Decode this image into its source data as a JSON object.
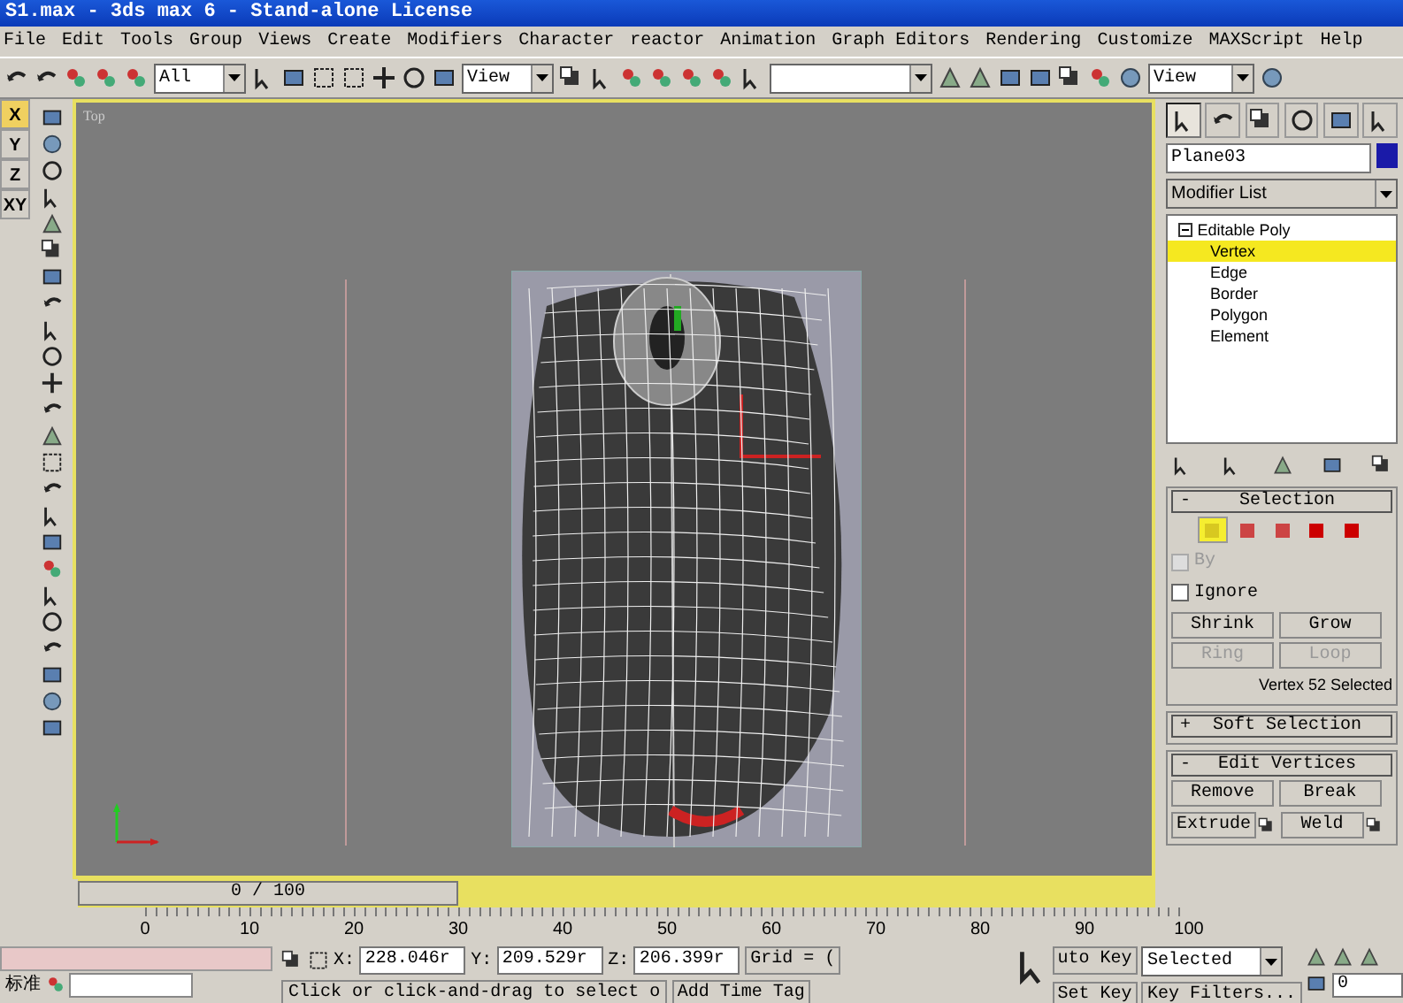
{
  "window": {
    "title": "S1.max - 3ds max 6 - Stand-alone License"
  },
  "menu": [
    "File",
    "Edit",
    "Tools",
    "Group",
    "Views",
    "Create",
    "Modifiers",
    "Character",
    "reactor",
    "Animation",
    "Graph Editors",
    "Rendering",
    "Customize",
    "MAXScript",
    "Help"
  ],
  "toolbar": {
    "selection_filter": "All",
    "reference_coord": "View",
    "viewport_layout": "View"
  },
  "axis_constraints": [
    {
      "label": "X",
      "selected": true
    },
    {
      "label": "Y",
      "selected": false
    },
    {
      "label": "Z",
      "selected": false
    },
    {
      "label": "XY",
      "selected": false
    }
  ],
  "viewport": {
    "label": "Top"
  },
  "command_panel": {
    "tabs": [
      {
        "selected": true
      },
      {
        "selected": false
      },
      {
        "selected": false
      },
      {
        "selected": false
      },
      {
        "selected": false
      },
      {
        "selected": false
      }
    ],
    "object_name": "Plane03",
    "modifier_list": "Modifier List",
    "stack": [
      {
        "label": "Editable Poly",
        "selected": false,
        "children": [
          {
            "label": "Vertex",
            "selected": true
          },
          {
            "label": "Edge",
            "selected": false
          },
          {
            "label": "Border",
            "selected": false
          },
          {
            "label": "Polygon",
            "selected": false
          },
          {
            "label": "Element",
            "selected": false
          }
        ]
      }
    ],
    "rollouts": [
      {
        "sign": "-",
        "title": "Selection",
        "kind": "selection",
        "subobjects": [
          {
            "selected": true
          },
          {
            "selected": false
          },
          {
            "selected": false
          },
          {
            "selected": false
          },
          {
            "selected": false
          }
        ],
        "checkboxes": [
          {
            "label": "By",
            "checked": false,
            "disabled": true
          },
          {
            "label": "Ignore",
            "checked": false,
            "disabled": false
          }
        ],
        "buttons": [
          {
            "label": "Shrink",
            "disabled": false
          },
          {
            "label": "Grow",
            "disabled": false
          },
          {
            "label": "Ring",
            "disabled": true
          },
          {
            "label": "Loop",
            "disabled": true
          }
        ],
        "status": "Vertex 52 Selected"
      },
      {
        "sign": "+",
        "title": "Soft Selection",
        "kind": "header"
      },
      {
        "sign": "-",
        "title": "Edit Vertices",
        "kind": "buttons",
        "buttons": [
          {
            "label": "Remove",
            "settings": false
          },
          {
            "label": "Break",
            "settings": false
          },
          {
            "label": "Extrude",
            "settings": true
          },
          {
            "label": "Weld",
            "settings": true
          }
        ]
      }
    ]
  },
  "timeline": {
    "frame_slider": "0 / 100",
    "level": 0,
    "ticks": [
      "0",
      "10",
      "20",
      "30",
      "40",
      "50",
      "60",
      "70",
      "80",
      "90",
      "100"
    ]
  },
  "status_bar": {
    "coords": [
      {
        "axis": "X:",
        "value": "228.046r"
      },
      {
        "axis": "Y:",
        "value": "209.529r"
      },
      {
        "axis": "Z:",
        "value": "206.399r"
      }
    ],
    "grid": "Grid = (",
    "auto_key": "uto Key",
    "key_mode": "Selected",
    "set_key": "Set Key",
    "key_filters": "Key Filters...",
    "prompt": "Click or click-and-drag to select o",
    "add_time_tag": "Add Time Tag",
    "current_frame": "0",
    "toolbar_label": "标准"
  }
}
